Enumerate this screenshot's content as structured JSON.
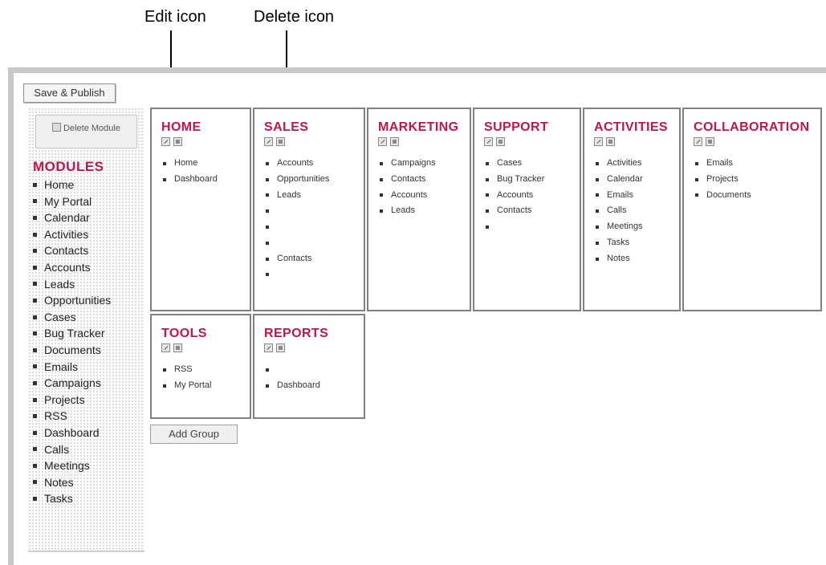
{
  "callouts": {
    "edit_label": "Edit icon",
    "delete_label": "Delete icon"
  },
  "toolbar": {
    "save_publish_label": "Save & Publish",
    "add_group_label": "Add Group"
  },
  "sidebar": {
    "delete_module_label": "Delete Module",
    "title": "MODULES",
    "items": [
      "Home",
      "My Portal",
      "Calendar",
      "Activities",
      "Contacts",
      "Accounts",
      "Leads",
      "Opportunities",
      "Cases",
      "Bug Tracker",
      "Documents",
      "Emails",
      "Campaigns",
      "Projects",
      "RSS",
      "Dashboard",
      "Calls",
      "Meetings",
      "Notes",
      "Tasks"
    ]
  },
  "groups": [
    {
      "title": "HOME",
      "items": [
        "Home",
        "Dashboard"
      ]
    },
    {
      "title": "SALES",
      "items": [
        "Accounts",
        "Opportunities",
        "Leads",
        "",
        "",
        "",
        "Contacts",
        ""
      ]
    },
    {
      "title": "MARKETING",
      "items": [
        "Campaigns",
        "Contacts",
        "Accounts",
        "Leads"
      ]
    },
    {
      "title": "SUPPORT",
      "items": [
        "Cases",
        "Bug Tracker",
        "Accounts",
        "Contacts",
        ""
      ]
    },
    {
      "title": "ACTIVITIES",
      "items": [
        "Activities",
        "Calendar",
        "Emails",
        "Calls",
        "Meetings",
        "Tasks",
        "Notes"
      ]
    },
    {
      "title": "COLLABORATION",
      "items": [
        "Emails",
        "Projects",
        "Documents"
      ]
    },
    {
      "title": "TOOLS",
      "items": [
        "RSS",
        "My Portal"
      ]
    },
    {
      "title": "REPORTS",
      "items": [
        "",
        "Dashboard"
      ]
    }
  ],
  "icons": {
    "edit": "edit-icon",
    "delete": "delete-icon"
  },
  "colors": {
    "group_title": "#c0174a",
    "box_border": "#7f7f7f"
  }
}
